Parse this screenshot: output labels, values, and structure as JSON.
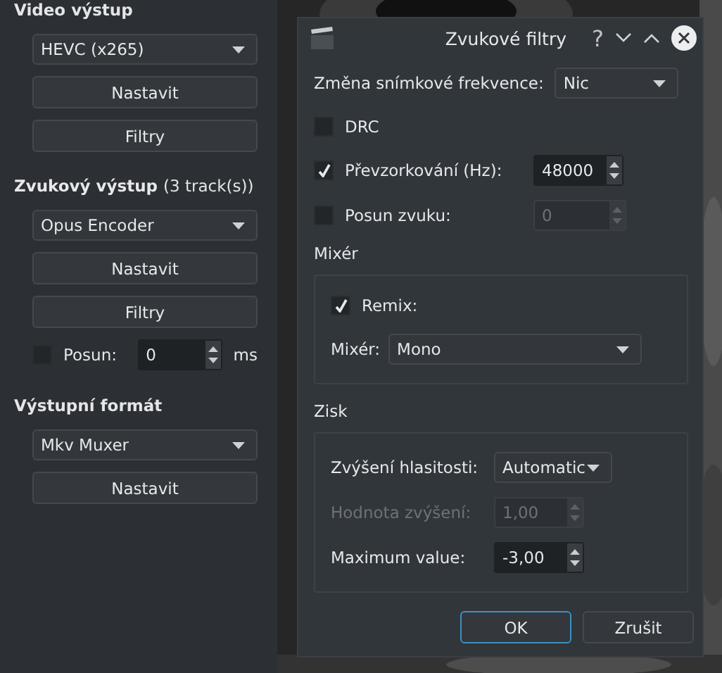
{
  "left_panel": {
    "video_heading": "Video výstup",
    "video_codec": "HEVC (x265)",
    "video_buttons": [
      "Nastavit",
      "Filtry"
    ],
    "audio_heading": "Zvukový výstup",
    "audio_note": "(3 track(s))",
    "audio_codec": "Opus Encoder",
    "audio_buttons": [
      "Nastavit",
      "Filtry"
    ],
    "shift": {
      "label": "Posun:",
      "checked": false,
      "value": "0",
      "unit": "ms"
    },
    "format_heading": "Výstupní formát",
    "format_value": "Mkv Muxer",
    "format_buttons": [
      "Nastavit"
    ]
  },
  "dialog": {
    "title": "Zvukové filtry",
    "help": "?",
    "framerate": {
      "label": "Změna snímkové frekvence:",
      "value": "Nic"
    },
    "drc": {
      "label": "DRC",
      "checked": false
    },
    "resample": {
      "label": "Převzorkování (Hz):",
      "checked": true,
      "value": "48000"
    },
    "audio_shift": {
      "label": "Posun zvuku:",
      "checked": false,
      "value": "0",
      "disabled": true
    },
    "mixer_group": {
      "title": "Mixér",
      "remix": {
        "label": "Remix:",
        "checked": true
      },
      "mixer": {
        "label": "Mixér:",
        "value": "Mono"
      }
    },
    "gain_group": {
      "title": "Zisk",
      "mode": {
        "label": "Zvýšení hlasitosti:",
        "value": "Automatic"
      },
      "gain_value": {
        "label": "Hodnota zvýšení:",
        "value": "1,00",
        "disabled": true
      },
      "maximum": {
        "label": "Maximum value:",
        "value": "-3,00",
        "disabled": false
      }
    },
    "buttons": [
      {
        "label": "OK",
        "default": true
      },
      {
        "label": "Zrušit",
        "default": false
      }
    ]
  }
}
